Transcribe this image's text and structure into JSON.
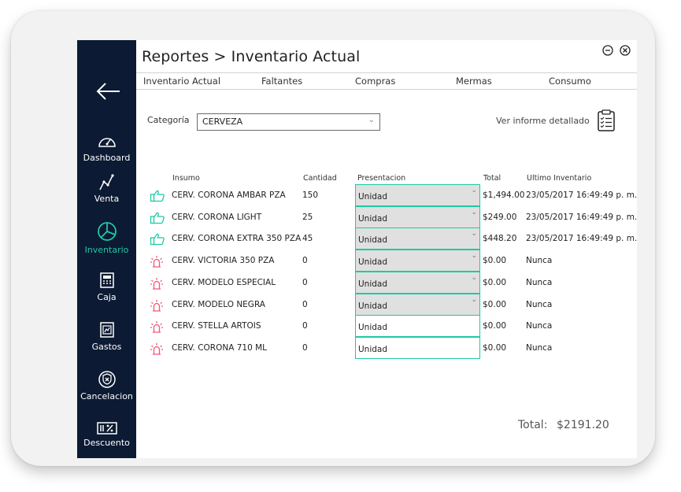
{
  "header": {
    "title": "Reportes > Inventario Actual"
  },
  "sidebar": {
    "items": [
      {
        "label": "Dashboard",
        "icon": "gauge-icon"
      },
      {
        "label": "Venta",
        "icon": "chart-line-icon"
      },
      {
        "label": "Inventario",
        "icon": "pie-chart-icon",
        "active": true
      },
      {
        "label": "Caja",
        "icon": "cash-register-icon"
      },
      {
        "label": "Gastos",
        "icon": "receipt-icon"
      },
      {
        "label": "Cancelacion",
        "icon": "shield-x-icon"
      },
      {
        "label": "Descuento",
        "icon": "discount-icon"
      }
    ]
  },
  "tabs": [
    {
      "label": "Inventario Actual"
    },
    {
      "label": "Faltantes"
    },
    {
      "label": "Compras"
    },
    {
      "label": "Mermas"
    },
    {
      "label": "Consumo"
    }
  ],
  "filters": {
    "category_label": "Categoría",
    "category_value": "CERVEZA",
    "report_link": "Ver informe detallado"
  },
  "table": {
    "headers": {
      "insumo": "Insumo",
      "cantidad": "Cantidad",
      "presentacion": "Presentacion",
      "total": "Total",
      "ultimo": "Ultimo Inventario"
    },
    "rows": [
      {
        "status": "ok",
        "insumo": "CERV. CORONA AMBAR PZA",
        "cantidad": "150",
        "presentacion": "Unidad",
        "total": "$1,494.00",
        "ultimo": "23/05/2017 16:49:49 p. m."
      },
      {
        "status": "ok",
        "insumo": "CERV. CORONA LIGHT",
        "cantidad": "25",
        "presentacion": "Unidad",
        "total": "$249.00",
        "ultimo": "23/05/2017 16:49:49 p. m."
      },
      {
        "status": "ok",
        "insumo": "CERV. CORONA EXTRA 350 PZA",
        "cantidad": "45",
        "presentacion": "Unidad",
        "total": "$448.20",
        "ultimo": "23/05/2017 16:49:49 p. m."
      },
      {
        "status": "alert",
        "insumo": "CERV. VICTORIA 350 PZA",
        "cantidad": "0",
        "presentacion": "Unidad",
        "total": "$0.00",
        "ultimo": "Nunca"
      },
      {
        "status": "alert",
        "insumo": "CERV. MODELO ESPECIAL",
        "cantidad": "0",
        "presentacion": "Unidad",
        "total": "$0.00",
        "ultimo": "Nunca"
      },
      {
        "status": "alert",
        "insumo": "CERV. MODELO NEGRA",
        "cantidad": "0",
        "presentacion": "Unidad",
        "total": "$0.00",
        "ultimo": "Nunca"
      },
      {
        "status": "alert",
        "insumo": "CERV. STELLA ARTOIS",
        "cantidad": "0",
        "presentacion": "Unidad",
        "total": "$0.00",
        "ultimo": "Nunca"
      },
      {
        "status": "alert",
        "insumo": "CERV. CORONA 710 ML",
        "cantidad": "0",
        "presentacion": "Unidad",
        "total": "$0.00",
        "ultimo": "Nunca"
      }
    ]
  },
  "footer": {
    "total_label": "Total:",
    "total_value": "$2191.20"
  },
  "colors": {
    "sidebar": "#0c1a33",
    "accent": "#1ec9a4",
    "alert": "#f2577a"
  }
}
